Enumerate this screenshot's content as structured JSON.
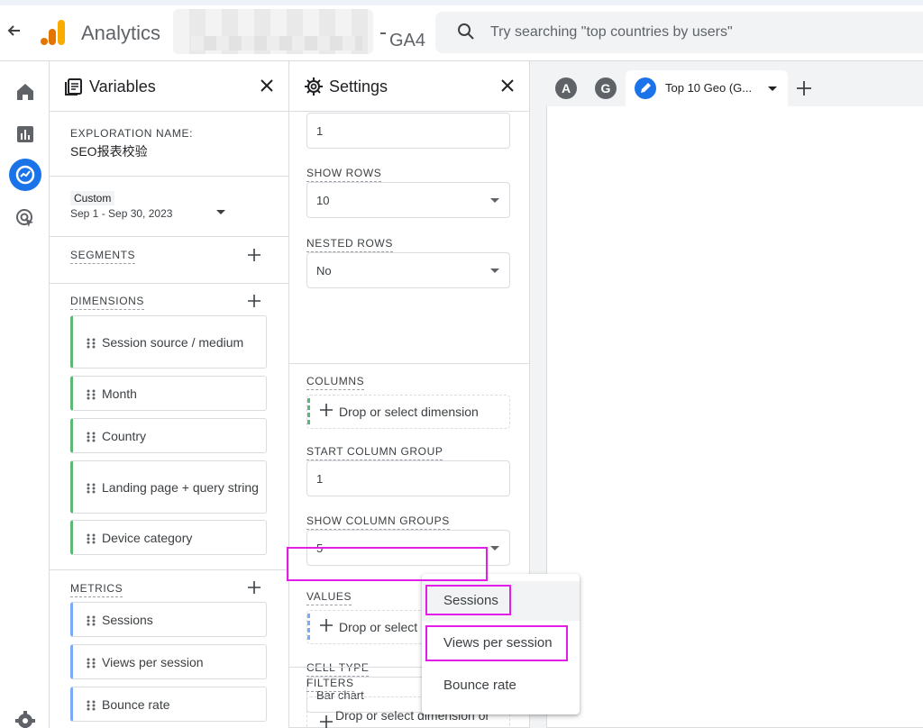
{
  "header": {
    "app_name": "Analytics",
    "property_suffix": "GA4",
    "search_placeholder": "Try searching \"top countries by users\""
  },
  "colors": {
    "accent": "#1a73e8",
    "dimension": "#5bb974",
    "metric": "#7baaf7",
    "highlight": "#e21de8"
  },
  "rail": {
    "icons": [
      "home-icon",
      "reports-icon",
      "explore-icon",
      "advertising-icon",
      "settings-icon"
    ]
  },
  "variables": {
    "title": "Variables",
    "exploration_label": "EXPLORATION NAME:",
    "exploration_name": "SEO报表校验",
    "date_badge": "Custom",
    "date_range": "Sep 1 - Sep 30, 2023",
    "segments_label": "SEGMENTS",
    "dimensions_label": "DIMENSIONS",
    "dimensions": [
      "Session source / medium",
      "Month",
      "Country",
      "Landing page + query string",
      "Device category"
    ],
    "metrics_label": "METRICS",
    "metrics": [
      "Sessions",
      "Views per session",
      "Bounce rate"
    ]
  },
  "settings": {
    "title": "Settings",
    "start_row_value": "1",
    "show_rows_label": "SHOW ROWS",
    "show_rows_value": "10",
    "nested_rows_label": "NESTED ROWS",
    "nested_rows_value": "No",
    "columns_label": "COLUMNS",
    "drop_dimension": "Drop or select dimension",
    "start_column_group_label": "START COLUMN GROUP",
    "start_column_group_value": "1",
    "show_column_groups_label": "SHOW COLUMN GROUPS",
    "show_column_groups_value": "5",
    "values_label": "VALUES",
    "drop_metric": "Drop or select metric",
    "cell_type_label": "CELL TYPE",
    "cell_type_value": "Bar chart",
    "filters_label": "FILTERS",
    "drop_filter": "Drop or select dimension or"
  },
  "tabs": {
    "avatars": [
      "A",
      "G"
    ],
    "active_tab": "Top 10 Geo (G..."
  },
  "metric_menu": [
    "Sessions",
    "Views per session",
    "Bounce rate"
  ]
}
